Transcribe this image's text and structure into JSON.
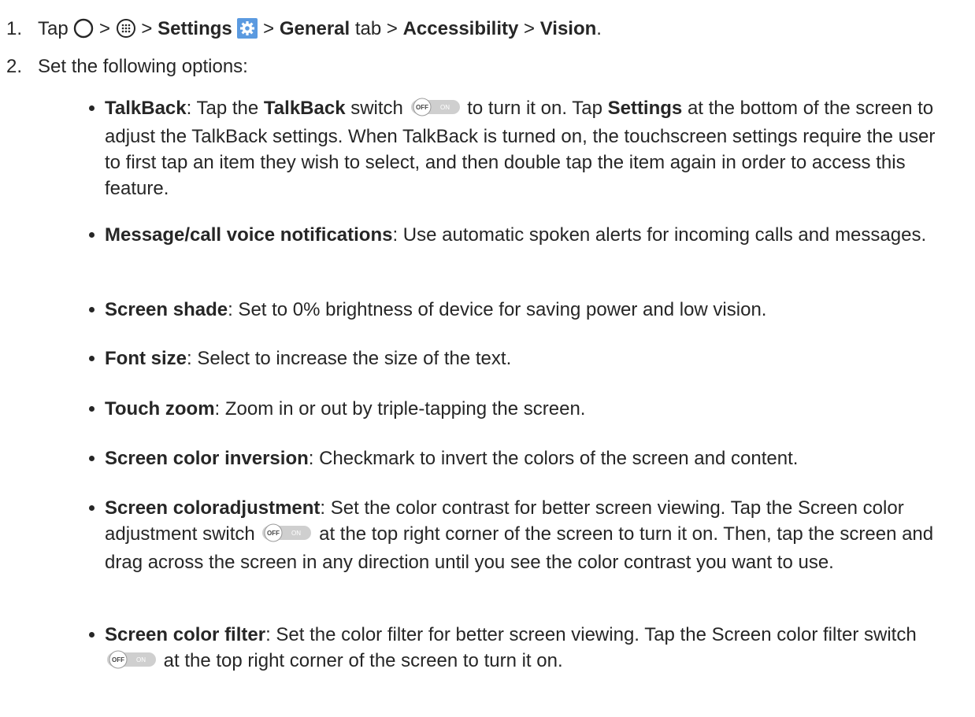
{
  "step1": {
    "num": "1.",
    "tap": "Tap",
    "sep1": ">",
    "sep2": ">",
    "settings": "Settings",
    "sep3": ">",
    "general": "General",
    "tab_word": " tab ",
    "sep4": ">",
    "accessibility": "Accessibility",
    "sep5": ">",
    "vision": "Vision",
    "period": "."
  },
  "step2": {
    "num": "2.",
    "text": "Set the following options:"
  },
  "icons": {
    "home": "home-circle-icon",
    "apps": "apps-grid-icon",
    "settings": "gear-icon",
    "toggle": "off-on-switch-icon",
    "settings_color": "#5b9ae0"
  },
  "toggle_labels": {
    "off": "OFF",
    "on": "ON"
  },
  "options": [
    {
      "title": "TalkBack",
      "t1": ": Tap the ",
      "t2": "TalkBack",
      "t3": " switch",
      "t4": " to turn it on. Tap ",
      "t5": "Settings",
      "t6": " at the bottom of the screen to adjust the TalkBack settings. When TalkBack is turned on, the touchscreen settings require the user to first tap an item they wish to select, and then double tap the item again in order to access this feature."
    },
    {
      "title": "Message/call voice notifications",
      "text": ": Use automatic spoken alerts for incoming calls and messages."
    },
    {
      "title": "Screen shade",
      "text": ": Set to 0% brightness of device for saving power and low vision."
    },
    {
      "title": "Font size",
      "text": ": Select to increase the size of the text."
    },
    {
      "title": "Touch zoom",
      "text": ": Zoom in or out by triple-tapping the screen."
    },
    {
      "title": "Screen color inversion",
      "text": ": Checkmark to invert the colors of the screen and content."
    },
    {
      "title": "Screen coloradjustment",
      "t1": ": Set the color contrast for better screen viewing. Tap the Screen color adjustment switch",
      "t2": " at the top right corner of the screen to turn it on. Then, tap the screen and drag across the screen in any direction until you see the color contrast you want to use."
    },
    {
      "title": "Screen color filter",
      "t1": ": Set the color filter for better screen viewing. Tap the Screen color filter switch",
      "t2": " at the top right corner of the screen to turn it on."
    }
  ]
}
